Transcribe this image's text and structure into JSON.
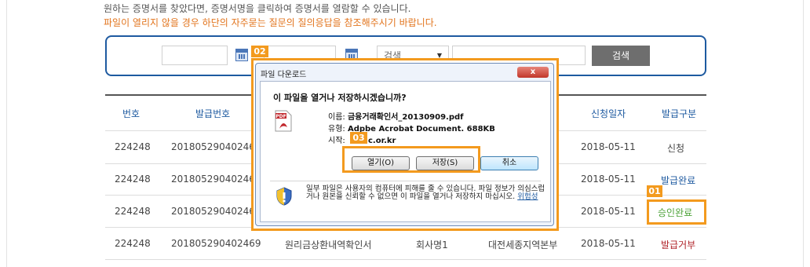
{
  "intro": {
    "line1": "원하는 증명서를 찾았다면, 증명서명을 클릭하여 증명서를 열람할 수 있습니다.",
    "line2": "파일이 열리지 않을 경우 하단의 자주묻는 질문의 질의응답을 참조해주시기 바랍니다."
  },
  "search": {
    "select_value": "검색",
    "button_label": "검색"
  },
  "table": {
    "headers": [
      "번호",
      "발급번호",
      "신청일자",
      "발급구분"
    ],
    "rows": [
      {
        "no": "224248",
        "issue_no": "201805290402469",
        "date": "2018-05-11",
        "status": "신청"
      },
      {
        "no": "224248",
        "issue_no": "201805290402469",
        "date": "2018-05-11",
        "status": "발급완료"
      },
      {
        "no": "224248",
        "issue_no": "201805290402469",
        "date": "2018-05-11",
        "status": "승인완료"
      },
      {
        "no": "224248",
        "issue_no": "201805290402469",
        "cert": "원리금상환내역확인서",
        "company": "회사명1",
        "branch": "대전세종지역본부",
        "date": "2018-05-11",
        "status": "발급거부"
      }
    ]
  },
  "dialog": {
    "title": "파일 다운로드",
    "question": "이 파일을 열거나 저장하시겠습니까?",
    "name_label": "이름:",
    "name_value": "금융거래확인서_20130909.pdf",
    "type_label": "유형:",
    "type_value": "Adpbe Acrobat Document. 688KB",
    "from_label": "시작:",
    "from_value": "c.or.kr",
    "open_label": "열기(O)",
    "save_label": "저장(S)",
    "cancel_label": "취소",
    "warning": "일부 파일은 사용자의 컴퓨터에 피해를 줄 수 있습니다. 파일 정보가 의심스럽거나 원본을 신뢰할 수 없으면 이 파일을 열거나 저장하지 마십시오.",
    "risk_link": "위험성",
    "close_label": "x"
  },
  "callouts": {
    "c01": "01",
    "c02": "02",
    "c03": "03"
  },
  "colors": {
    "accent": "#f39a1e",
    "brand_blue": "#1e5aa0",
    "approved_green": "#4ea33a",
    "rejected_red": "#b0242a"
  }
}
